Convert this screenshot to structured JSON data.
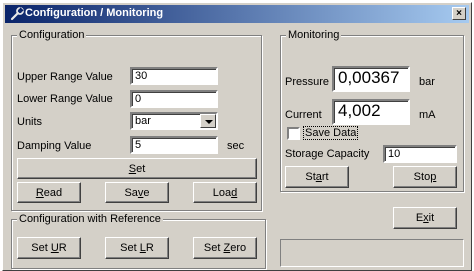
{
  "window": {
    "title": "Configuration / Monitoring",
    "close_label": "×"
  },
  "configuration": {
    "legend": "Configuration",
    "upper_range": {
      "label": "Upper Range Value",
      "value": "30"
    },
    "lower_range": {
      "label": "Lower Range Value",
      "value": "0"
    },
    "units": {
      "label": "Units",
      "selected": "bar"
    },
    "damping": {
      "label": "Damping Value",
      "value": "5",
      "unit": "sec"
    },
    "set_button": {
      "mnemonic": "S",
      "rest": "et"
    },
    "read_button": {
      "mnemonic": "R",
      "rest": "ead"
    },
    "save_button": {
      "pre": "Sa",
      "mnemonic": "v",
      "rest": "e"
    },
    "load_button": {
      "pre": "Loa",
      "mnemonic": "d",
      "rest": ""
    }
  },
  "reference": {
    "legend": "Configuration with Reference",
    "set_ur": {
      "pre": "Set ",
      "mnemonic": "U",
      "rest": "R"
    },
    "set_lr": {
      "pre": "Set ",
      "mnemonic": "L",
      "rest": "R"
    },
    "set_zero": {
      "pre": "Set ",
      "mnemonic": "Z",
      "rest": "ero"
    }
  },
  "monitoring": {
    "legend": "Monitoring",
    "pressure": {
      "label": "Pressure",
      "value": "0,00367",
      "unit": "bar"
    },
    "current": {
      "label": "Current",
      "value": "4,002",
      "unit": "mA"
    },
    "save_data": {
      "label": "Save Data",
      "checked": false
    },
    "storage": {
      "label": "Storage Capacity",
      "value": "10"
    },
    "start_button": {
      "pre": "St",
      "mnemonic": "a",
      "rest": "rt"
    },
    "stop_button": {
      "pre": "Sto",
      "mnemonic": "p",
      "rest": ""
    }
  },
  "exit_button": {
    "pre": "E",
    "mnemonic": "x",
    "rest": "it"
  },
  "status_text": ""
}
